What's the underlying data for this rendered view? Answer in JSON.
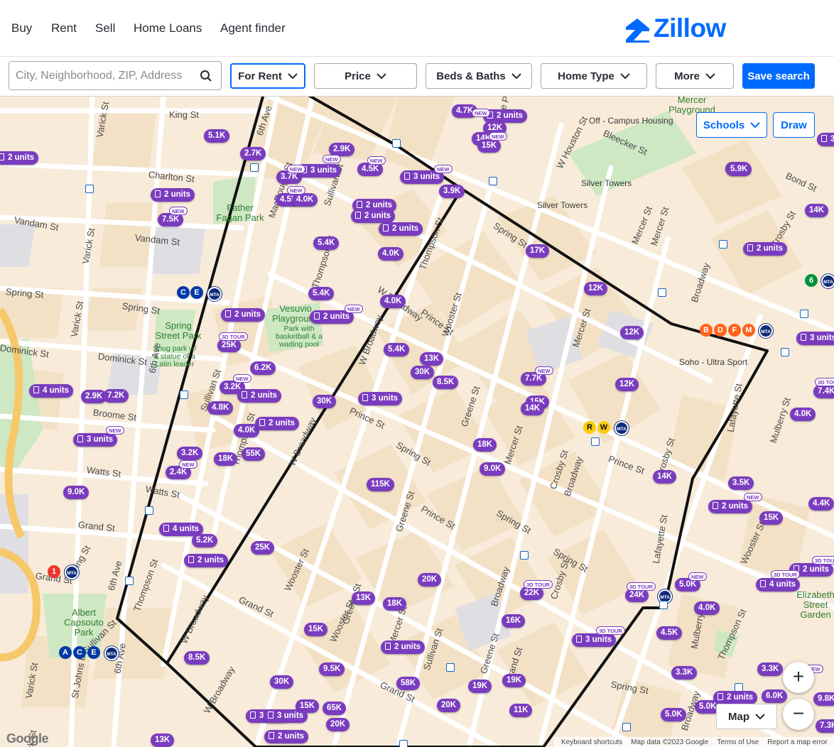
{
  "nav": {
    "links": [
      "Buy",
      "Rent",
      "Sell",
      "Home Loans",
      "Agent finder"
    ],
    "logo": "Zillow"
  },
  "filters": {
    "search_placeholder": "City, Neighborhood, ZIP, Address",
    "for_rent": "For Rent",
    "price": "Price",
    "beds_baths": "Beds & Baths",
    "home_type": "Home Type",
    "more": "More",
    "save_search": "Save search"
  },
  "map_tools": {
    "schools": "Schools",
    "draw": "Draw",
    "map_type": "Map",
    "zoom_in": "+",
    "zoom_out": "−"
  },
  "attribution": {
    "google": "Google",
    "keyboard": "Keyboard shortcuts",
    "map_data": "Map data ©2023 Google",
    "terms": "Terms of Use",
    "report": "Report a map error"
  },
  "colors": {
    "accent": "#006aff",
    "pin": "#7a3cbf",
    "park": "#cde8c3",
    "polygon": "#111111"
  },
  "streets": [
    "King St",
    "Charlton St",
    "Vandam St",
    "Vandam St",
    "Varick St",
    "Varick St",
    "Varick St",
    "Varick St",
    "Spring St",
    "Spring St",
    "Dominick St",
    "Dominick St",
    "Broome St",
    "Watts St",
    "Watts St",
    "Grand St",
    "Grand St",
    "6th Ave",
    "6th Ave",
    "6th Ave",
    "MacDougal St",
    "Sullivan St",
    "Sullivan St",
    "Sullivan St",
    "Thompson St",
    "Thompson St",
    "Thompson St",
    "Thompson St",
    "W Broadway",
    "W Broadway",
    "W Broadway",
    "W Broadway",
    "W Broadway",
    "Prince St",
    "Prince St",
    "Prince St",
    "Spring St",
    "Spring St",
    "Spring St",
    "Spring St",
    "Spring St",
    "W Houston St",
    "Wooster St",
    "Wooster St",
    "Wooster St",
    "Greene St",
    "Greene St",
    "Greene St",
    "Greene St",
    "Mercer St",
    "Mercer St",
    "Mercer St",
    "Mercer St",
    "Crosby St",
    "Crosby St",
    "Crosby St",
    "Broadway",
    "Broadway",
    "Broadway",
    "Broadway",
    "Lafayette St",
    "Lafayette St",
    "Mulberry St",
    "Mulberry St",
    "Bleecker St",
    "Bond St",
    "Crosby St",
    "Mercer St",
    "Greene Pl",
    "Prince St",
    "Grand St",
    "Grand St",
    "Grand St",
    "St Johns Ln",
    "6th Ave",
    "Varick St",
    "Thompson St",
    "Spring St",
    "Sullivan St",
    "Grand St",
    "Wooster St",
    "Mercer St",
    "Prince St"
  ],
  "places": {
    "poi": [
      "Off - Campus Housing",
      "Silver Towers",
      "Silver Towers",
      "Soho - Ultra Sport"
    ],
    "parks": [
      "Mercer Playground",
      "Father Fagan Park",
      "Vesuvio Playground",
      "Park with basketball & a wading pool",
      "Spring Street Park",
      "Snug park w/ a statue of a Latin leader",
      "Albert Capsouto Park",
      "Elizabeth Street Garden"
    ]
  },
  "subway": {
    "lines": [
      "C",
      "E",
      "MTA",
      "6",
      "MTA",
      "B",
      "D",
      "F",
      "M",
      "MTA",
      "R",
      "W",
      "MTA",
      "1",
      "MTA",
      "A",
      "C",
      "E",
      "MTA",
      "MTA"
    ]
  },
  "listings": [
    {
      "label": "2 units",
      "units": true
    },
    {
      "label": "5.1K"
    },
    {
      "label": "2.7K"
    },
    {
      "label": "2 units",
      "units": true
    },
    {
      "label": "7.5K"
    },
    {
      "label": "2.9K"
    },
    {
      "label": "3.7K"
    },
    {
      "label": "3 units",
      "units": true
    },
    {
      "label": "4.5K"
    },
    {
      "label": "3 units",
      "units": true
    },
    {
      "label": "3.9K"
    },
    {
      "label": "4.5K"
    },
    {
      "label": "4.0K"
    },
    {
      "label": "2 units",
      "units": true
    },
    {
      "label": "2 units",
      "units": true
    },
    {
      "label": "2 units",
      "units": true
    },
    {
      "label": "4.7K"
    },
    {
      "label": "2 units",
      "units": true
    },
    {
      "label": "12K"
    },
    {
      "label": "14K"
    },
    {
      "label": "15K"
    },
    {
      "label": "3.5K"
    },
    {
      "label": "5.4K"
    },
    {
      "label": "4.0K"
    },
    {
      "label": "5.9K"
    },
    {
      "label": "2 units",
      "units": true
    },
    {
      "label": "14K"
    },
    {
      "label": "5.4K"
    },
    {
      "label": "2 units",
      "units": true
    },
    {
      "label": "2 units",
      "units": true
    },
    {
      "label": "4.0K"
    },
    {
      "label": "17K"
    },
    {
      "label": "12K"
    },
    {
      "label": "25K"
    },
    {
      "label": "5.4K"
    },
    {
      "label": "13K"
    },
    {
      "label": "30K"
    },
    {
      "label": "8.5K"
    },
    {
      "label": "12K"
    },
    {
      "label": "6.2K"
    },
    {
      "label": "3.2K"
    },
    {
      "label": "2 units",
      "units": true
    },
    {
      "label": "4 units",
      "units": true
    },
    {
      "label": "2.9K"
    },
    {
      "label": "7.2K"
    },
    {
      "label": "4.8K"
    },
    {
      "label": "30K"
    },
    {
      "label": "3 units",
      "units": true
    },
    {
      "label": "7.7K"
    },
    {
      "label": "15K"
    },
    {
      "label": "14K"
    },
    {
      "label": "12K"
    },
    {
      "label": "4.0K"
    },
    {
      "label": "2 units",
      "units": true
    },
    {
      "label": "3 units",
      "units": true
    },
    {
      "label": "3.2K"
    },
    {
      "label": "18K"
    },
    {
      "label": "55K"
    },
    {
      "label": "18K"
    },
    {
      "label": "9.0K"
    },
    {
      "label": "2.4K"
    },
    {
      "label": "9.0K"
    },
    {
      "label": "115K"
    },
    {
      "label": "14K"
    },
    {
      "label": "3.5K"
    },
    {
      "label": "2 units",
      "units": true
    },
    {
      "label": "15K"
    },
    {
      "label": "4 units",
      "units": true
    },
    {
      "label": "5.2K"
    },
    {
      "label": "2 units",
      "units": true
    },
    {
      "label": "25K"
    },
    {
      "label": "4 units",
      "units": true
    },
    {
      "label": "20K"
    },
    {
      "label": "22K"
    },
    {
      "label": "3 units",
      "units": true
    },
    {
      "label": "5.0K"
    },
    {
      "label": "24K"
    },
    {
      "label": "13K"
    },
    {
      "label": "18K"
    },
    {
      "label": "2 units",
      "units": true
    },
    {
      "label": "16K"
    },
    {
      "label": "4.0K"
    },
    {
      "label": "15K"
    },
    {
      "label": "4.5K"
    },
    {
      "label": "2 units",
      "units": true
    },
    {
      "label": "3 units",
      "units": true
    },
    {
      "label": "8.5K"
    },
    {
      "label": "9.5K"
    },
    {
      "label": "3.3K"
    },
    {
      "label": "30K"
    },
    {
      "label": "58K"
    },
    {
      "label": "19K"
    },
    {
      "label": "19K"
    },
    {
      "label": "15K"
    },
    {
      "label": "65K"
    },
    {
      "label": "20K"
    },
    {
      "label": "11K"
    },
    {
      "label": "3 units",
      "units": true
    },
    {
      "label": "2 units",
      "units": true
    },
    {
      "label": "20K"
    },
    {
      "label": "5.0K"
    },
    {
      "label": "5.0K"
    },
    {
      "label": "13K"
    },
    {
      "label": "4.4K"
    },
    {
      "label": "4.0K"
    },
    {
      "label": "7.4K"
    },
    {
      "label": "3 units",
      "units": true
    },
    {
      "label": "2 units",
      "units": true
    },
    {
      "label": "3.3K"
    },
    {
      "label": "6.0K"
    },
    {
      "label": "9.8K"
    },
    {
      "label": "7.3K"
    },
    {
      "label": "3 units",
      "units": true
    }
  ],
  "tags": [
    "NEW",
    "NEW",
    "NEW",
    "NEW",
    "NEW",
    "NEW",
    "NEW",
    "NEW",
    "NEW",
    "NEW",
    "NEW",
    "NEW",
    "NEW",
    "NEW",
    "3D TOUR",
    "3D TOUR",
    "3D TOUR",
    "3D TOUR",
    "3D TOUR",
    "3D TOUR",
    "NEW",
    "NEW",
    "3D TOUR"
  ]
}
